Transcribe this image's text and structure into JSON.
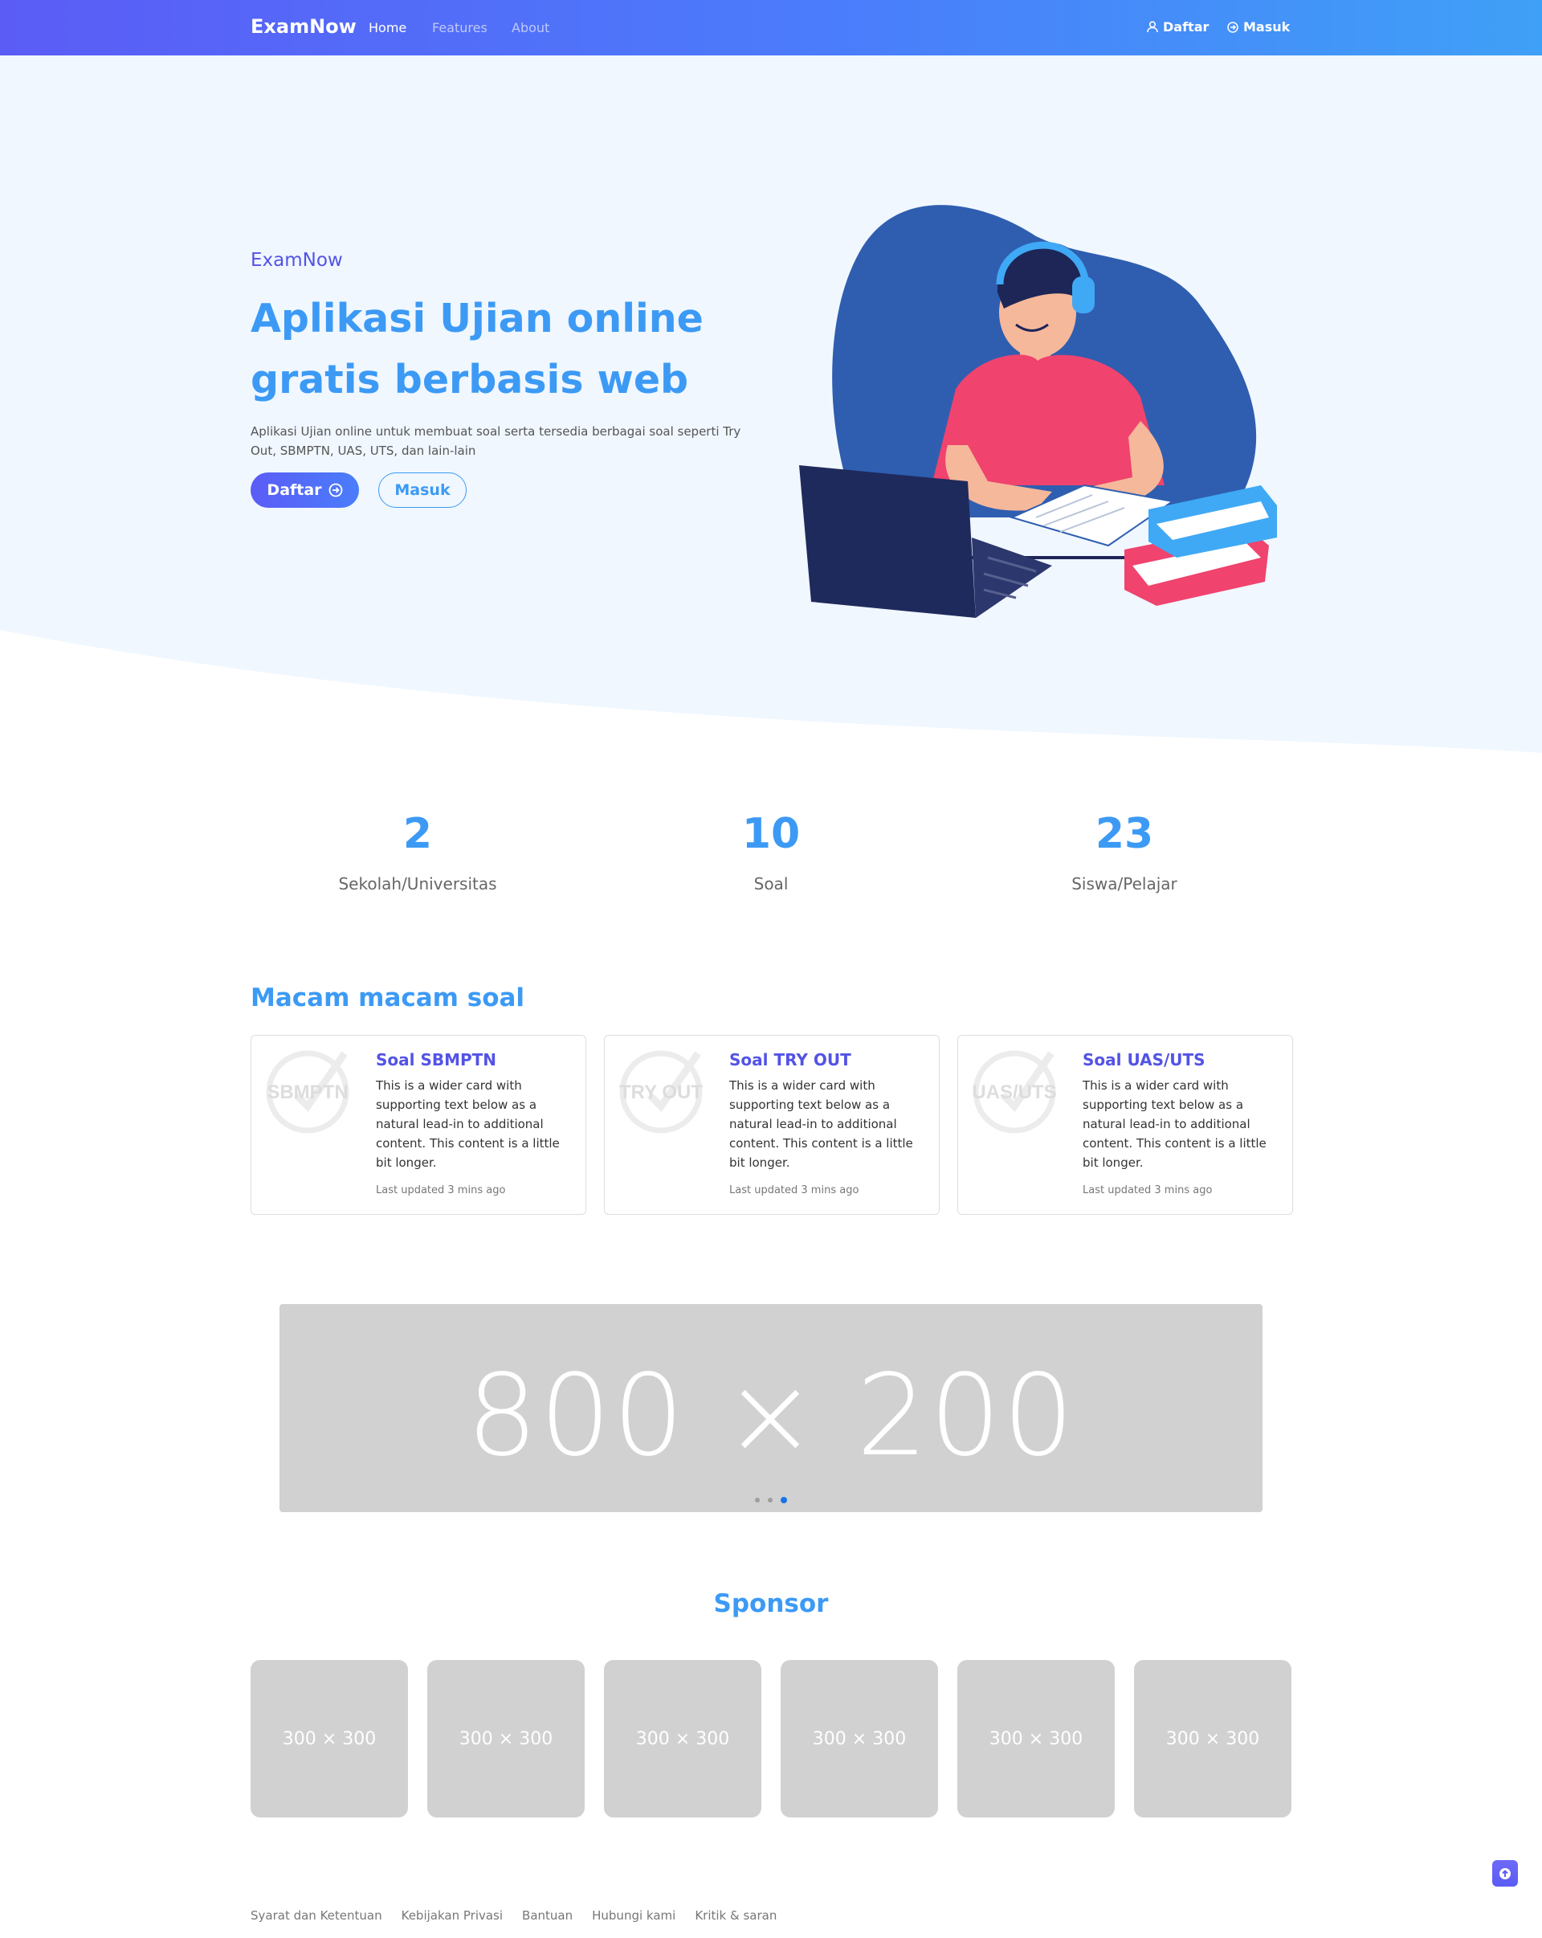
{
  "navbar": {
    "brand": "ExamNow",
    "links": [
      {
        "label": "Home",
        "active": true
      },
      {
        "label": "Features",
        "active": false
      },
      {
        "label": "About",
        "active": false
      }
    ],
    "right": [
      {
        "label": "Daftar",
        "icon": "user-icon"
      },
      {
        "label": "Masuk",
        "icon": "login-circle-icon"
      }
    ]
  },
  "hero": {
    "kicker": "ExamNow",
    "title": "Aplikasi Ujian online gratis berbasis web",
    "description": "Aplikasi Ujian online untuk membuat soal serta tersedia berbagai soal seperti Try Out, SBMPTN, UAS, UTS, dan lain-lain",
    "btn_daftar": "Daftar",
    "btn_masuk": "Masuk",
    "illustration": "student-with-laptop-illustration"
  },
  "stats": [
    {
      "value": "2",
      "label": "Sekolah/Universitas"
    },
    {
      "value": "10",
      "label": "Soal"
    },
    {
      "value": "23",
      "label": "Siswa/Pelajar"
    }
  ],
  "soal_section": {
    "title": "Macam macam soal",
    "cards": [
      {
        "logo_text": "SBMPTN",
        "title": "Soal SBMPTN",
        "text": "This is a wider card with supporting text below as a natural lead-in to additional content. This content is a little bit longer.",
        "meta": "Last updated 3 mins ago"
      },
      {
        "logo_text": "TRY OUT",
        "title": "Soal TRY OUT",
        "text": "This is a wider card with supporting text below as a natural lead-in to additional content. This content is a little bit longer.",
        "meta": "Last updated 3 mins ago"
      },
      {
        "logo_text": "UAS/UTS",
        "title": "Soal UAS/UTS",
        "text": "This is a wider card with supporting text below as a natural lead-in to additional content. This content is a little bit longer.",
        "meta": "Last updated 3 mins ago"
      }
    ]
  },
  "carousel": {
    "placeholder": "800 × 200",
    "slides": 3,
    "active_slide": 3
  },
  "sponsor": {
    "title": "Sponsor",
    "items": [
      "300 × 300",
      "300 × 300",
      "300 × 300",
      "300 × 300",
      "300 × 300",
      "300 × 300"
    ]
  },
  "footer": {
    "links": [
      "Syarat dan Ketentuan",
      "Kebijakan Privasi",
      "Bantuan",
      "Hubungi kami",
      "Kritik & saran"
    ],
    "back_to_top_icon": "arrow-up-icon"
  },
  "colors": {
    "primary": "#5b5cf6",
    "accent": "#3c9af5",
    "hero_bg": "#f0f7ff",
    "placeholder": "#d1d1d1"
  }
}
